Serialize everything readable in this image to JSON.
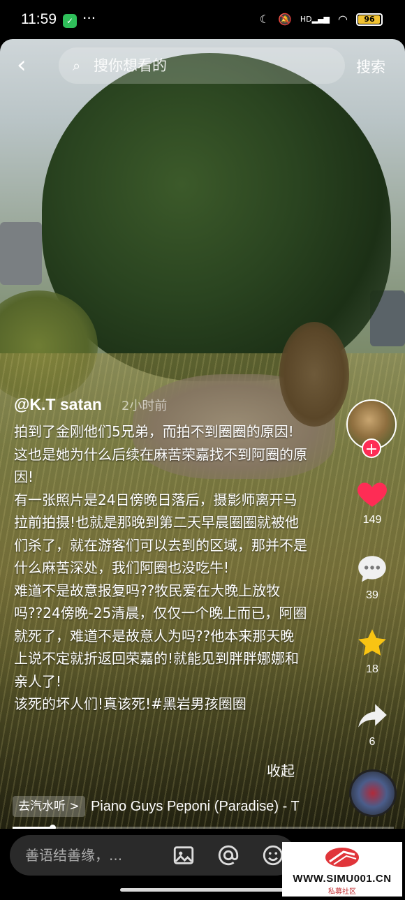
{
  "status_bar": {
    "time": "11:59",
    "dots": "···",
    "battery_level": "96",
    "network_label": "HD"
  },
  "search": {
    "placeholder": "搜你想看的",
    "button_label": "搜索"
  },
  "post": {
    "author": "@K.T satan",
    "time_ago": "2小时前",
    "caption": "拍到了金刚他们5兄弟，而拍不到圈圈的原因!这也是她为什么后续在麻苦荣嘉找不到阿圈的原因!\n有一张照片是24日傍晚日落后，摄影师离开马拉前拍摄!也就是那晚到第二天早晨圈圈就被他们杀了，就在游客们可以去到的区域，那并不是什么麻苦深处，我们阿圈也没吃牛!\n难道不是故意报复吗??牧民爱在大晚上放牧吗??24傍晚-25清晨，仅仅一个晚上而已，阿圈就死了，难道不是故意人为吗??他本来那天晚上说不定就折返回荣嘉的!就能见到胖胖娜娜和亲人了!\n该死的坏人们!真该死!#黑岩男孩圈圈",
    "collapse_label": "收起"
  },
  "actions": {
    "like_count": "149",
    "comment_count": "39",
    "favorite_count": "18",
    "share_count": "6",
    "follow_symbol": "+"
  },
  "music": {
    "tag_label": "去汽水听 >",
    "title": "Piano Guys    Peponi (Paradise) - T"
  },
  "playback": {
    "progress": 0.104
  },
  "comment_bar": {
    "placeholder": "善语结善缘，..."
  },
  "watermark": {
    "url": "WWW.SIMU001.CN",
    "subtitle": "私募社区"
  },
  "colors": {
    "like_red": "#fe2c55",
    "favorite_yellow": "#f9c413",
    "follow_red": "#fe2c55"
  }
}
